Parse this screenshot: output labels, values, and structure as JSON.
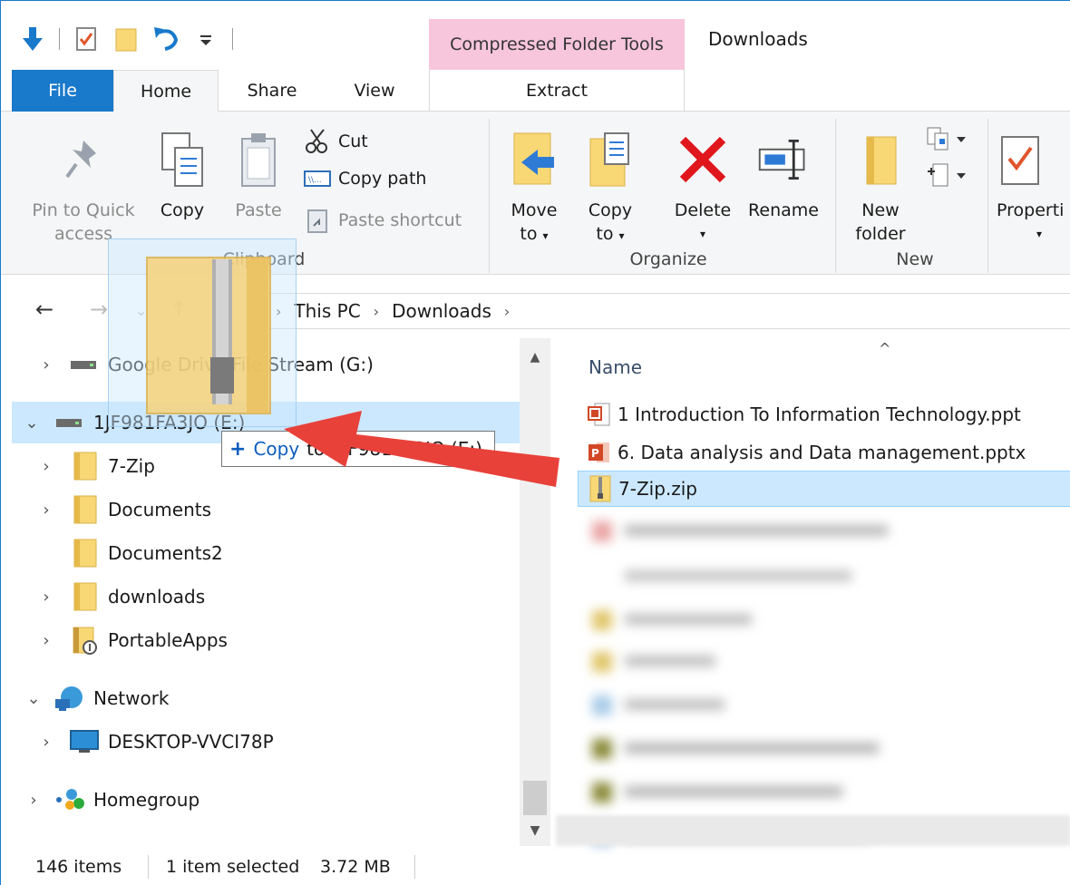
{
  "window": {
    "title": "Downloads",
    "context_tab_header": "Compressed Folder Tools"
  },
  "quick_access_toolbar": {
    "icons": [
      "down-arrow-icon",
      "properties-check-icon",
      "new-folder-icon",
      "undo-icon",
      "customize-dropdown-icon"
    ]
  },
  "tabs": {
    "file": "File",
    "home": "Home",
    "share": "Share",
    "view": "View",
    "extract": "Extract"
  },
  "ribbon": {
    "clipboard": {
      "pin_line1": "Pin to Quick",
      "pin_line2": "access",
      "copy": "Copy",
      "paste": "Paste",
      "cut": "Cut",
      "copy_path": "Copy path",
      "paste_shortcut": "Paste shortcut",
      "group_label": "Clipboard"
    },
    "organize": {
      "move_line1": "Move",
      "move_line2": "to",
      "copy_line1": "Copy",
      "copy_line2": "to",
      "delete": "Delete",
      "rename": "Rename",
      "group_label": "Organize"
    },
    "new": {
      "new_folder_line1": "New",
      "new_folder_line2": "folder",
      "group_label": "New"
    },
    "open": {
      "properties": "Properti"
    }
  },
  "address": {
    "crumbs": [
      "This PC",
      "Downloads"
    ]
  },
  "nav_tree": [
    {
      "label": "Google Drive File Stream (G:)",
      "expander": "›",
      "icon": "drive-icon"
    },
    {
      "label": "1JF981FA3JO (E:)",
      "expander": "⌄",
      "icon": "drive-icon"
    },
    {
      "label": "7-Zip",
      "expander": "›",
      "icon": "folder-icon"
    },
    {
      "label": "Documents",
      "expander": "›",
      "icon": "folder-icon"
    },
    {
      "label": "Documents2",
      "expander": "",
      "icon": "folder-icon"
    },
    {
      "label": "downloads",
      "expander": "›",
      "icon": "folder-icon"
    },
    {
      "label": "PortableApps",
      "expander": "›",
      "icon": "portableapps-icon"
    },
    {
      "label": "Network",
      "expander": "⌄",
      "icon": "network-icon"
    },
    {
      "label": "DESKTOP-VVCI78P",
      "expander": "›",
      "icon": "computer-icon"
    },
    {
      "label": "Homegroup",
      "expander": "›",
      "icon": "homegroup-icon"
    }
  ],
  "file_list": {
    "column_name": "Name",
    "files": [
      {
        "name": "1 Introduction To Information Technology.ppt",
        "icon": "ppt-icon"
      },
      {
        "name": "6. Data analysis and Data management.pptx",
        "icon": "pptx-icon"
      },
      {
        "name": "7-Zip.zip",
        "icon": "zip-folder-icon"
      }
    ]
  },
  "drag": {
    "action": "+ Copy",
    "action_word": "Copy",
    "target": "to 1JF981FA3JO (E:)"
  },
  "status": {
    "item_count": "146 items",
    "selection": "1 item selected",
    "size": "3.72 MB"
  },
  "colors": {
    "accent": "#1979ca",
    "context_tab": "#f7c5dc",
    "selection": "#cce8ff",
    "arrow": "#e8413a",
    "folder": "#f8d775"
  }
}
